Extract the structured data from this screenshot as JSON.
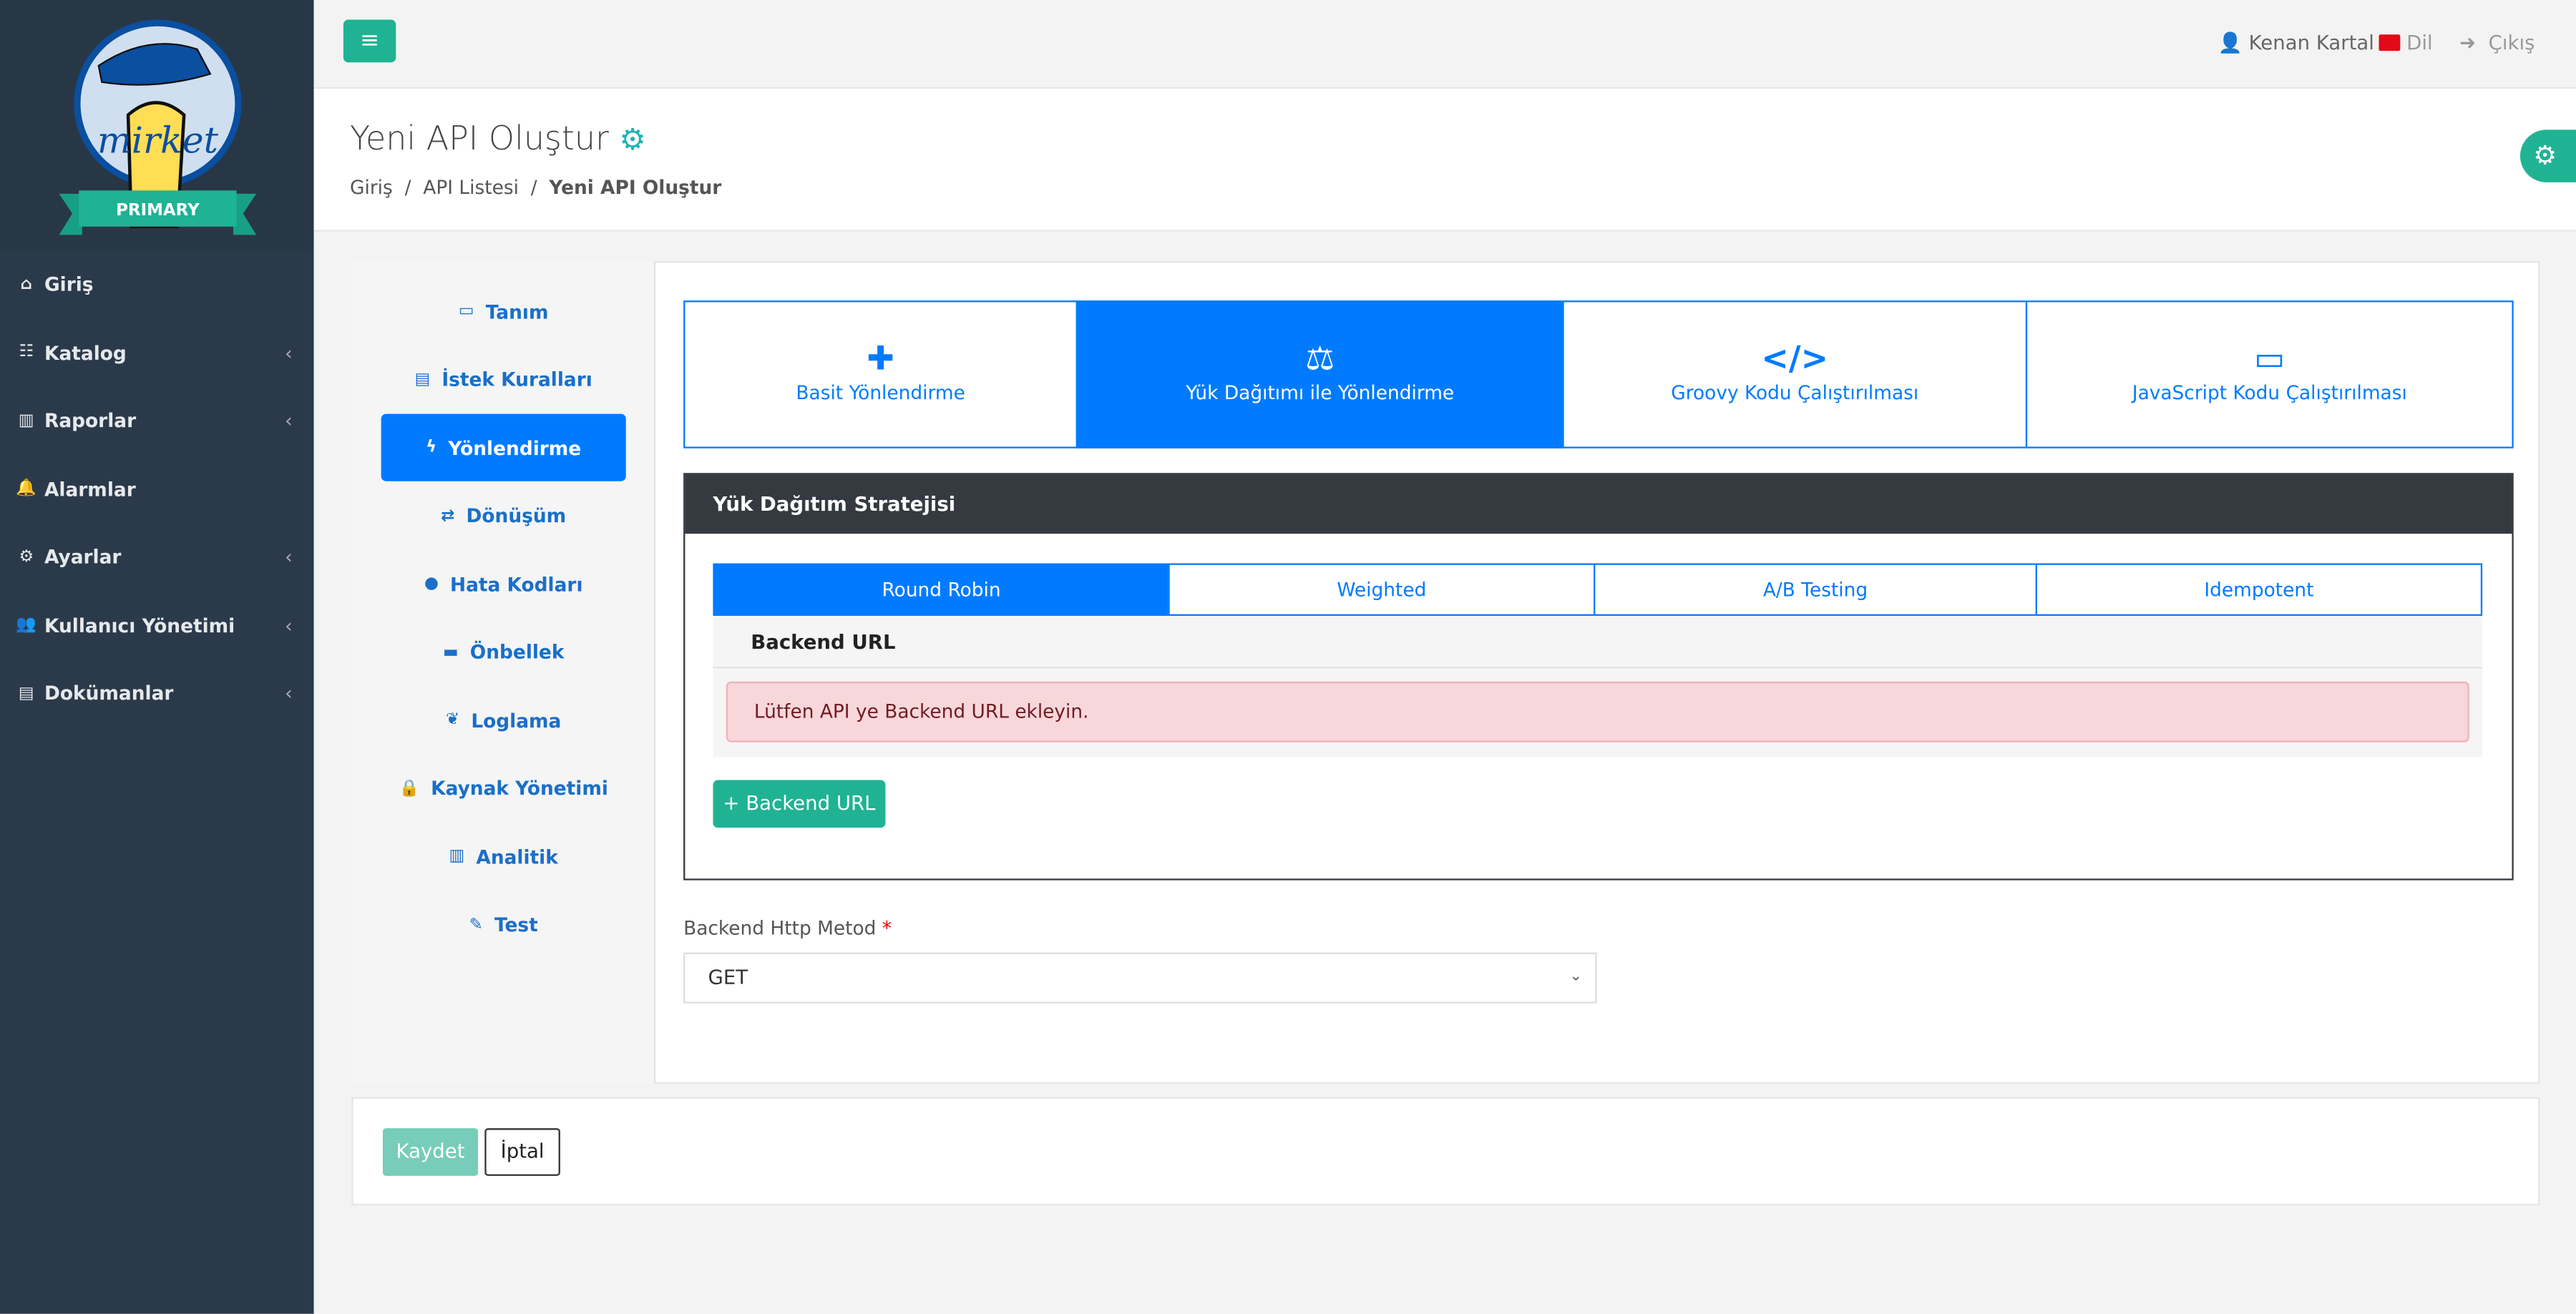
{
  "brand": {
    "logo_text": "mirket",
    "badge": "PRIMARY"
  },
  "sidebar": {
    "items": [
      {
        "label": "Giriş",
        "icon": "home-icon",
        "chevron": false
      },
      {
        "label": "Katalog",
        "icon": "sitemap-icon",
        "chevron": true
      },
      {
        "label": "Raporlar",
        "icon": "chart-icon",
        "chevron": true
      },
      {
        "label": "Alarmlar",
        "icon": "bell-icon",
        "chevron": false
      },
      {
        "label": "Ayarlar",
        "icon": "gears-icon",
        "chevron": true
      },
      {
        "label": "Kullanıcı Yönetimi",
        "icon": "users-icon",
        "chevron": true
      },
      {
        "label": "Dokümanlar",
        "icon": "file-icon",
        "chevron": true
      }
    ]
  },
  "topbar": {
    "user": "Kenan Kartal",
    "language": "Dil",
    "logout": "Çıkış"
  },
  "header": {
    "title": "Yeni API Oluştur",
    "breadcrumb": [
      "Giriş",
      "API Listesi",
      "Yeni API Oluştur"
    ]
  },
  "left_tabs": [
    {
      "label": "Tanım",
      "icon": "id-card-icon"
    },
    {
      "label": "İstek Kuralları",
      "icon": "file-icon"
    },
    {
      "label": "Yönlendirme",
      "icon": "bolt-icon",
      "active": true
    },
    {
      "label": "Dönüşüm",
      "icon": "exchange-icon"
    },
    {
      "label": "Hata Kodları",
      "icon": "exclamation-circle-icon"
    },
    {
      "label": "Önbellek",
      "icon": "memory-icon"
    },
    {
      "label": "Loglama",
      "icon": "leaf-icon"
    },
    {
      "label": "Kaynak Yönetimi",
      "icon": "lock-icon"
    },
    {
      "label": "Analitik",
      "icon": "chart-icon"
    },
    {
      "label": "Test",
      "icon": "pencil-icon"
    }
  ],
  "routing_tabs": [
    {
      "label": "Basit Yönlendirme",
      "icon": "puzzle-icon"
    },
    {
      "label": "Yük Dağıtımı ile Yönlendirme",
      "icon": "balance-scale-icon",
      "active": true
    },
    {
      "label": "Groovy Kodu Çalıştırılması",
      "icon": "code-icon"
    },
    {
      "label": "JavaScript Kodu Çalıştırılması",
      "icon": "laptop-code-icon"
    }
  ],
  "strategy": {
    "title": "Yük Dağıtım Stratejisi",
    "tabs": [
      "Round Robin",
      "Weighted",
      "A/B Testing",
      "Idempotent"
    ],
    "active": "Round Robin",
    "column": "Backend URL",
    "empty_message": "Lütfen API ye Backend URL ekleyin.",
    "add_button": "+ Backend URL"
  },
  "method": {
    "label": "Backend Http Metod",
    "required": "*",
    "value": "GET"
  },
  "footer": {
    "save": "Kaydet",
    "cancel": "İptal"
  },
  "colors": {
    "primary": "#007bff",
    "accent": "#1fb394",
    "sidebar": "#2b3a4a",
    "panel_header": "#343a40",
    "alert_bg": "#f8d7da"
  }
}
